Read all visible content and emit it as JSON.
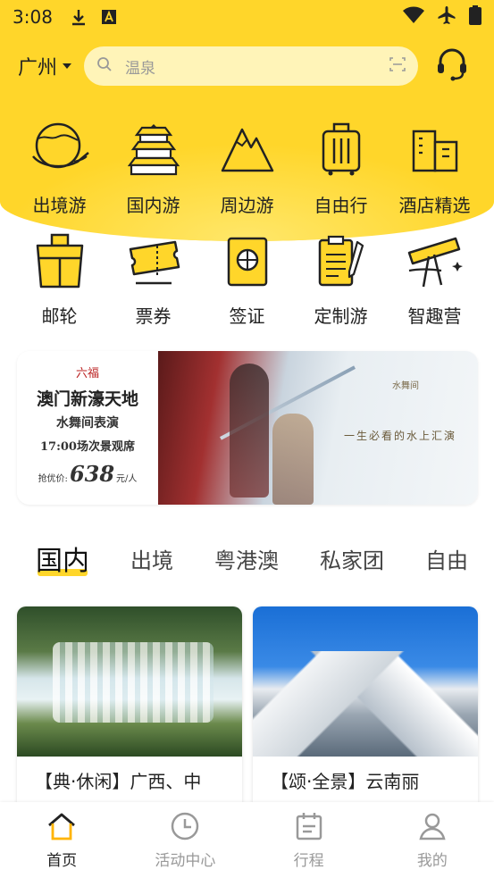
{
  "status_bar": {
    "time": "3:08"
  },
  "topbar": {
    "city": "广州",
    "search_placeholder": "温泉"
  },
  "categories_row1": [
    {
      "label": "出境游",
      "icon": "globe-hand-icon"
    },
    {
      "label": "国内游",
      "icon": "temple-icon"
    },
    {
      "label": "周边游",
      "icon": "mountain-icon"
    },
    {
      "label": "自由行",
      "icon": "luggage-icon"
    },
    {
      "label": "酒店精选",
      "icon": "hotel-icon"
    }
  ],
  "categories_row2": [
    {
      "label": "邮轮",
      "icon": "cruise-icon"
    },
    {
      "label": "票券",
      "icon": "ticket-icon"
    },
    {
      "label": "签证",
      "icon": "passport-icon"
    },
    {
      "label": "定制游",
      "icon": "clipboard-pen-icon"
    },
    {
      "label": "智趣营",
      "icon": "telescope-icon"
    }
  ],
  "banner": {
    "logo": "六福",
    "title": "澳门新濠天地",
    "subtitle": "水舞间表演",
    "time": "17:00场次景观席",
    "price_label": "抢优价:",
    "price": "638",
    "price_unit": "元/人",
    "slogan": "一生必看的水上汇演",
    "brand": "水舞间"
  },
  "tabs": [
    {
      "label": "国内",
      "active": true
    },
    {
      "label": "出境",
      "active": false
    },
    {
      "label": "粤港澳",
      "active": false
    },
    {
      "label": "私家团",
      "active": false
    },
    {
      "label": "自由",
      "active": false
    }
  ],
  "cards": [
    {
      "caption": "【典·休闲】广西、中",
      "image": "waterfall"
    },
    {
      "caption": "【颂·全景】云南丽",
      "image": "snow-mountain"
    }
  ],
  "bottom_nav": [
    {
      "label": "首页",
      "icon": "home-icon",
      "active": true
    },
    {
      "label": "活动中心",
      "icon": "clock-icon",
      "active": false
    },
    {
      "label": "行程",
      "icon": "calendar-icon",
      "active": false
    },
    {
      "label": "我的",
      "icon": "user-icon",
      "active": false
    }
  ],
  "colors": {
    "accent": "#ffd62a",
    "search_bg": "#fff4b8"
  }
}
